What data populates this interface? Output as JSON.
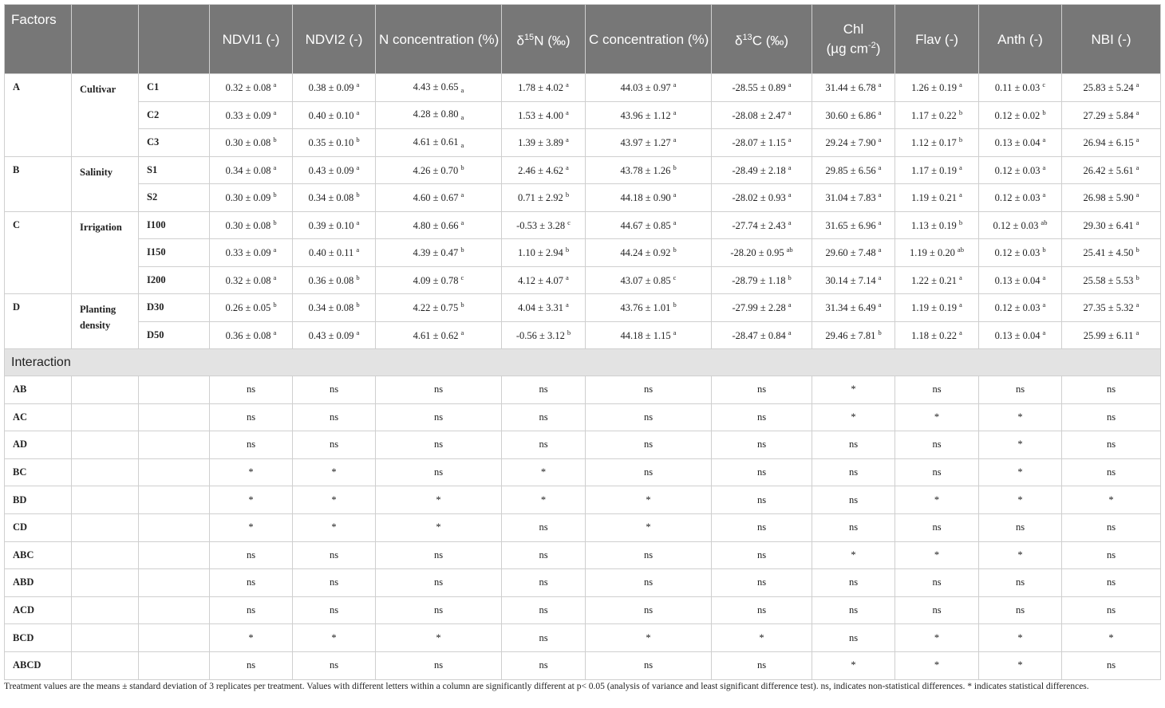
{
  "header": {
    "factors": "Factors",
    "ndvi1": "NDVI1 (-)",
    "ndvi2": "NDVI2 (-)",
    "n_conc": "N concentration (%)",
    "d15n_pre": "δ",
    "d15n_sup": "15",
    "d15n_post": "N (‰)",
    "c_conc": "C concentration (%)",
    "d13c_pre": "δ",
    "d13c_sup": "13",
    "d13c_post": "C (‰)",
    "chl_line1": "Chl",
    "chl_line2_pre": "(µg cm",
    "chl_sup": "-2",
    "chl_line2_post": ")",
    "flav": "Flav (-)",
    "anth": "Anth (-)",
    "nbi": "NBI (-)"
  },
  "factors": [
    {
      "code": "A",
      "name": "Cultivar",
      "levels": [
        {
          "level": "C1",
          "values": [
            [
              "0.32 ± 0.08",
              "a"
            ],
            [
              "0.38 ± 0.09",
              "a"
            ],
            [
              "4.43 ± 0.65",
              "a",
              "sub"
            ],
            [
              "1.78 ± 4.02",
              "a"
            ],
            [
              "44.03 ± 0.97",
              "a"
            ],
            [
              "-28.55 ± 0.89",
              "a"
            ],
            [
              "31.44 ± 6.78",
              "a"
            ],
            [
              "1.26 ± 0.19",
              "a"
            ],
            [
              "0.11 ± 0.03",
              "c"
            ],
            [
              "25.83 ± 5.24",
              "a"
            ]
          ]
        },
        {
          "level": "C2",
          "values": [
            [
              "0.33 ± 0.09",
              "a"
            ],
            [
              "0.40 ± 0.10",
              "a"
            ],
            [
              "4.28 ± 0.80",
              "a",
              "sub"
            ],
            [
              "1.53 ± 4.00",
              "a"
            ],
            [
              "43.96 ± 1.12",
              "a"
            ],
            [
              "-28.08 ± 2.47",
              "a"
            ],
            [
              "30.60 ± 6.86",
              "a"
            ],
            [
              "1.17 ± 0.22",
              "b"
            ],
            [
              "0.12 ± 0.02",
              "b"
            ],
            [
              "27.29 ± 5.84",
              "a"
            ]
          ]
        },
        {
          "level": "C3",
          "values": [
            [
              "0.30 ± 0.08",
              "b"
            ],
            [
              "0.35 ± 0.10",
              "b"
            ],
            [
              "4.61 ± 0.61",
              "a",
              "sub"
            ],
            [
              "1.39 ± 3.89",
              "a"
            ],
            [
              "43.97 ± 1.27",
              "a"
            ],
            [
              "-28.07 ± 1.15",
              "a"
            ],
            [
              "29.24 ± 7.90",
              "a"
            ],
            [
              "1.12 ± 0.17",
              "b"
            ],
            [
              "0.13 ± 0.04",
              "a"
            ],
            [
              "26.94 ± 6.15",
              "a"
            ]
          ]
        }
      ]
    },
    {
      "code": "B",
      "name": "Salinity",
      "levels": [
        {
          "level": "S1",
          "values": [
            [
              "0.34 ± 0.08",
              "a"
            ],
            [
              "0.43 ± 0.09",
              "a"
            ],
            [
              "4.26 ± 0.70",
              "b"
            ],
            [
              "2.46 ± 4.62",
              "a"
            ],
            [
              "43.78 ± 1.26",
              "b"
            ],
            [
              "-28.49 ± 2.18",
              "a"
            ],
            [
              "29.85 ± 6.56",
              "a"
            ],
            [
              "1.17 ± 0.19",
              "a"
            ],
            [
              "0.12 ± 0.03",
              "a"
            ],
            [
              "26.42 ± 5.61",
              "a"
            ]
          ]
        },
        {
          "level": "S2",
          "values": [
            [
              "0.30 ± 0.09",
              "b"
            ],
            [
              "0.34 ± 0.08",
              "b"
            ],
            [
              "4.60 ± 0.67",
              "a"
            ],
            [
              "0.71 ± 2.92",
              "b"
            ],
            [
              "44.18 ± 0.90",
              "a"
            ],
            [
              "-28.02 ± 0.93",
              "a"
            ],
            [
              "31.04 ± 7.83",
              "a"
            ],
            [
              "1.19 ± 0.21",
              "a"
            ],
            [
              "0.12 ± 0.03",
              "a"
            ],
            [
              "26.98 ± 5.90",
              "a"
            ]
          ]
        }
      ]
    },
    {
      "code": "C",
      "name": "Irrigation",
      "levels": [
        {
          "level": "I100",
          "values": [
            [
              "0.30 ± 0.08",
              "b"
            ],
            [
              "0.39 ± 0.10",
              "a"
            ],
            [
              "4.80 ± 0.66",
              "a"
            ],
            [
              "-0.53 ± 3.28",
              "c"
            ],
            [
              "44.67 ± 0.85",
              "a"
            ],
            [
              "-27.74 ± 2.43",
              "a"
            ],
            [
              "31.65 ± 6.96",
              "a"
            ],
            [
              "1.13 ± 0.19",
              "b"
            ],
            [
              "0.12 ± 0.03",
              "ab"
            ],
            [
              "29.30 ± 6.41",
              "a"
            ]
          ]
        },
        {
          "level": "I150",
          "values": [
            [
              "0.33 ± 0.09",
              "a"
            ],
            [
              "0.40 ± 0.11",
              "a"
            ],
            [
              "4.39 ± 0.47",
              "b"
            ],
            [
              "1.10 ± 2.94",
              "b"
            ],
            [
              "44.24 ± 0.92",
              "b"
            ],
            [
              "-28.20 ± 0.95",
              "ab"
            ],
            [
              "29.60 ± 7.48",
              "a"
            ],
            [
              "1.19 ± 0.20",
              "ab"
            ],
            [
              "0.12 ± 0.03",
              "b"
            ],
            [
              "25.41 ± 4.50",
              "b"
            ]
          ]
        },
        {
          "level": "I200",
          "values": [
            [
              "0.32 ± 0.08",
              "a"
            ],
            [
              "0.36 ± 0.08",
              "b"
            ],
            [
              "4.09 ± 0.78",
              "c"
            ],
            [
              "4.12 ± 4.07",
              "a"
            ],
            [
              "43.07 ± 0.85",
              "c"
            ],
            [
              "-28.79 ± 1.18",
              "b"
            ],
            [
              "30.14 ± 7.14",
              "a"
            ],
            [
              "1.22 ± 0.21",
              "a"
            ],
            [
              "0.13 ± 0.04",
              "a"
            ],
            [
              "25.58 ± 5.53",
              "b"
            ]
          ]
        }
      ]
    },
    {
      "code": "D",
      "name": "Planting density",
      "levels": [
        {
          "level": "D30",
          "values": [
            [
              "0.26 ± 0.05",
              "b"
            ],
            [
              "0.34 ± 0.08",
              "b"
            ],
            [
              "4.22 ± 0.75",
              "b"
            ],
            [
              "4.04 ± 3.31",
              "a"
            ],
            [
              "43.76 ± 1.01",
              "b"
            ],
            [
              "-27.99 ± 2.28",
              "a"
            ],
            [
              "31.34 ± 6.49",
              "a"
            ],
            [
              "1.19 ± 0.19",
              "a"
            ],
            [
              "0.12 ± 0.03",
              "a"
            ],
            [
              "27.35 ± 5.32",
              "a"
            ]
          ]
        },
        {
          "level": "D50",
          "values": [
            [
              "0.36 ± 0.08",
              "a"
            ],
            [
              "0.43 ± 0.09",
              "a"
            ],
            [
              "4.61 ± 0.62",
              "a"
            ],
            [
              "-0.56 ± 3.12",
              "b"
            ],
            [
              "44.18 ± 1.15",
              "a"
            ],
            [
              "-28.47 ± 0.84",
              "a"
            ],
            [
              "29.46 ± 7.81",
              "b"
            ],
            [
              "1.18 ± 0.22",
              "a"
            ],
            [
              "0.13 ± 0.04",
              "a"
            ],
            [
              "25.99 ± 6.11",
              "a"
            ]
          ]
        }
      ]
    }
  ],
  "interaction_label": "Interaction",
  "interactions": [
    {
      "label": "AB",
      "values": [
        "ns",
        "ns",
        "ns",
        "ns",
        "ns",
        "ns",
        "*",
        "ns",
        "ns",
        "ns"
      ]
    },
    {
      "label": "AC",
      "values": [
        "ns",
        "ns",
        "ns",
        "ns",
        "ns",
        "ns",
        "*",
        "*",
        "*",
        "ns"
      ]
    },
    {
      "label": "AD",
      "values": [
        "ns",
        "ns",
        "ns",
        "ns",
        "ns",
        "ns",
        "ns",
        "ns",
        "*",
        "ns"
      ]
    },
    {
      "label": "BC",
      "values": [
        "*",
        "*",
        "ns",
        "*",
        "ns",
        "ns",
        "ns",
        "ns",
        "*",
        "ns"
      ]
    },
    {
      "label": "BD",
      "values": [
        "*",
        "*",
        "*",
        "*",
        "*",
        "ns",
        "ns",
        "*",
        "*",
        "*"
      ]
    },
    {
      "label": "CD",
      "values": [
        "*",
        "*",
        "*",
        "ns",
        "*",
        "ns",
        "ns",
        "ns",
        "ns",
        "ns"
      ]
    },
    {
      "label": "ABC",
      "values": [
        "ns",
        "ns",
        "ns",
        "ns",
        "ns",
        "ns",
        "*",
        "*",
        "*",
        "ns"
      ]
    },
    {
      "label": "ABD",
      "values": [
        "ns",
        "ns",
        "ns",
        "ns",
        "ns",
        "ns",
        "ns",
        "ns",
        "ns",
        "ns"
      ]
    },
    {
      "label": "ACD",
      "values": [
        "ns",
        "ns",
        "ns",
        "ns",
        "ns",
        "ns",
        "ns",
        "ns",
        "ns",
        "ns"
      ]
    },
    {
      "label": "BCD",
      "values": [
        "*",
        "*",
        "*",
        "ns",
        "*",
        "*",
        "ns",
        "*",
        "*",
        "*"
      ]
    },
    {
      "label": "ABCD",
      "values": [
        "ns",
        "ns",
        "ns",
        "ns",
        "ns",
        "ns",
        "*",
        "*",
        "*",
        "ns"
      ]
    }
  ],
  "footnote": "Treatment values are the means ± standard deviation of 3 replicates per treatment. Values with different letters within a column are significantly different at p< 0.05 (analysis of variance and least significant difference test). ns, indicates non-statistical differences. * indicates statistical differences.",
  "colors": {
    "header_bg": "#777777",
    "section_bg": "#e3e3e3",
    "border": "#cfcfcf"
  }
}
